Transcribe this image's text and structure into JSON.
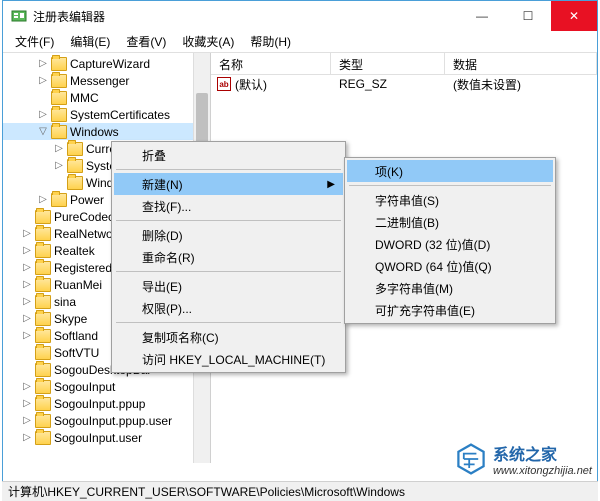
{
  "window": {
    "title": "注册表编辑器"
  },
  "winbtns": {
    "min": "—",
    "max": "☐",
    "close": "✕"
  },
  "menu": {
    "file": "文件(F)",
    "edit": "编辑(E)",
    "view": "查看(V)",
    "fav": "收藏夹(A)",
    "help": "帮助(H)"
  },
  "tree": [
    {
      "indent": 2,
      "exp": "▷",
      "label": "CaptureWizard"
    },
    {
      "indent": 2,
      "exp": "▷",
      "label": "Messenger"
    },
    {
      "indent": 2,
      "exp": "",
      "label": "MMC"
    },
    {
      "indent": 2,
      "exp": "▷",
      "label": "SystemCertificates"
    },
    {
      "indent": 2,
      "exp": "▽",
      "label": "Windows",
      "sel": true
    },
    {
      "indent": 3,
      "exp": "▷",
      "label": "Curre"
    },
    {
      "indent": 3,
      "exp": "▷",
      "label": "Syste"
    },
    {
      "indent": 3,
      "exp": "",
      "label": "Windows"
    },
    {
      "indent": 2,
      "exp": "▷",
      "label": "Power"
    },
    {
      "indent": 1,
      "exp": "",
      "label": "PureCodec"
    },
    {
      "indent": 1,
      "exp": "▷",
      "label": "RealNetworks"
    },
    {
      "indent": 1,
      "exp": "▷",
      "label": "Realtek"
    },
    {
      "indent": 1,
      "exp": "▷",
      "label": "RegisteredAppl"
    },
    {
      "indent": 1,
      "exp": "▷",
      "label": "RuanMei"
    },
    {
      "indent": 1,
      "exp": "▷",
      "label": "sina"
    },
    {
      "indent": 1,
      "exp": "▷",
      "label": "Skype"
    },
    {
      "indent": 1,
      "exp": "▷",
      "label": "Softland"
    },
    {
      "indent": 1,
      "exp": "",
      "label": "SoftVTU"
    },
    {
      "indent": 1,
      "exp": "",
      "label": "SogouDesktopBar"
    },
    {
      "indent": 1,
      "exp": "▷",
      "label": "SogouInput"
    },
    {
      "indent": 1,
      "exp": "▷",
      "label": "SogouInput.ppup"
    },
    {
      "indent": 1,
      "exp": "▷",
      "label": "SogouInput.ppup.user"
    },
    {
      "indent": 1,
      "exp": "▷",
      "label": "SogouInput.user"
    }
  ],
  "list": {
    "headers": {
      "name": "名称",
      "type": "类型",
      "data": "数据"
    },
    "rows": [
      {
        "icon": "ab",
        "name": "(默认)",
        "type": "REG_SZ",
        "data": "(数值未设置)"
      }
    ]
  },
  "ctx1": [
    {
      "label": "折叠"
    },
    {
      "sep": true
    },
    {
      "label": "新建(N)",
      "sub": true,
      "hl": true
    },
    {
      "label": "查找(F)..."
    },
    {
      "sep": true
    },
    {
      "label": "删除(D)"
    },
    {
      "label": "重命名(R)"
    },
    {
      "sep": true
    },
    {
      "label": "导出(E)"
    },
    {
      "label": "权限(P)..."
    },
    {
      "sep": true
    },
    {
      "label": "复制项名称(C)"
    },
    {
      "label": "访问 HKEY_LOCAL_MACHINE(T)"
    }
  ],
  "ctx2": [
    {
      "label": "项(K)",
      "hl": true
    },
    {
      "sep": true
    },
    {
      "label": "字符串值(S)"
    },
    {
      "label": "二进制值(B)"
    },
    {
      "label": "DWORD (32 位)值(D)"
    },
    {
      "label": "QWORD (64 位)值(Q)"
    },
    {
      "label": "多字符串值(M)"
    },
    {
      "label": "可扩充字符串值(E)"
    }
  ],
  "status": "计算机\\HKEY_CURRENT_USER\\SOFTWARE\\Policies\\Microsoft\\Windows",
  "watermark": {
    "brand": "系统之家",
    "url": "www.xitongzhijia.net"
  }
}
